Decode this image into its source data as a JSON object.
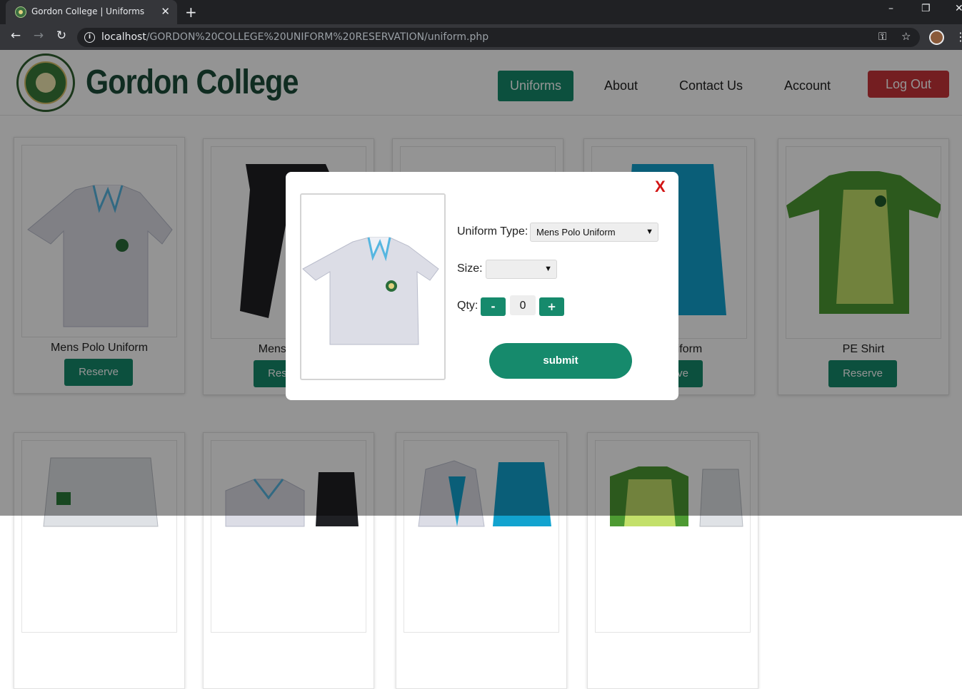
{
  "browser": {
    "tab_title": "Gordon College | Uniforms",
    "new_tab": "+",
    "url_host": "localhost",
    "url_path": "/GORDON%20COLLEGE%20UNIFORM%20RESERVATION/uniform.php",
    "window_controls": [
      "–",
      "❐",
      "✕"
    ]
  },
  "header": {
    "brand": "Gordon College",
    "nav": [
      "Uniforms",
      "About",
      "Contact Us",
      "Account"
    ],
    "active_nav": "Uniforms",
    "logout": "Log Out",
    "accent": "#168a6c",
    "logout_color": "#c9353a"
  },
  "cards_row1": [
    {
      "name": "Mens Polo Uniform",
      "button": "Reserve"
    },
    {
      "name": "Mens Pants",
      "button": "Reserve"
    },
    {
      "name": "",
      "button": ""
    },
    {
      "name": "Skirt Uniform",
      "button": "Reserve"
    },
    {
      "name": "PE Shirt",
      "button": "Reserve"
    }
  ],
  "modal": {
    "close": "X",
    "uniform_type_label": "Uniform Type:",
    "uniform_type_value": "Mens Polo Uniform",
    "size_label": "Size:",
    "size_value": "",
    "qty_label": "Qty:",
    "minus": "-",
    "qty_value": "0",
    "plus": "+",
    "submit": "submit"
  }
}
